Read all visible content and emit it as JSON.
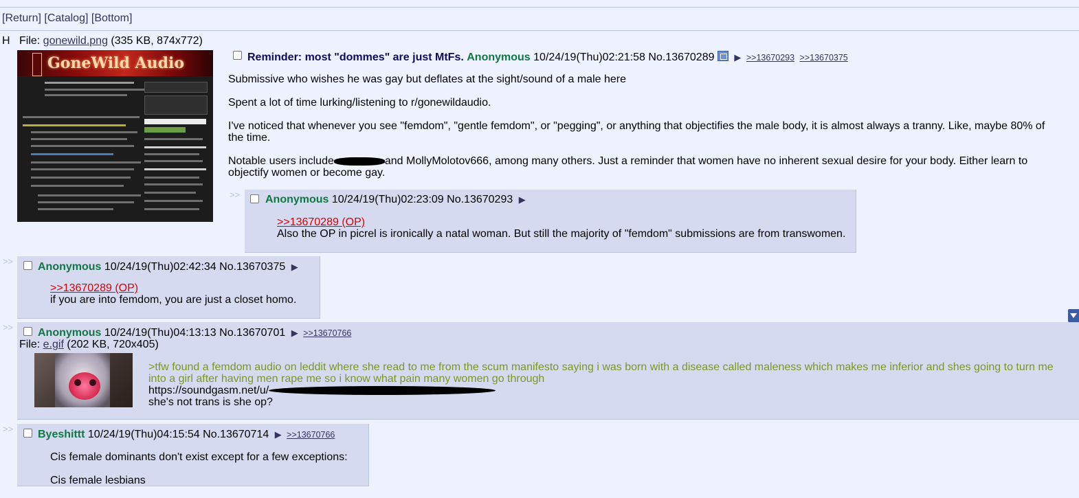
{
  "nav": {
    "return_label": "[Return]",
    "catalog_label": "[Catalog]",
    "bottom_label": "[Bottom]"
  },
  "board_letter": "H",
  "op": {
    "file_prefix": "File: ",
    "file_name": "gonewild.png",
    "file_meta": " (335 KB, 874x772)",
    "thumb_title": "GoneWild Audio",
    "subject": "Reminder: most \"dommes\" are just MtFs.",
    "name": "Anonymous",
    "datetime": "10/24/19(Thu)02:21:58",
    "post_no": "No.13670289",
    "backlinks": [
      ">>13670293",
      ">>13670375"
    ],
    "paragraphs": [
      "Submissive who wishes he was gay but deflates at the sight/sound of a male here",
      "Spent a lot of time lurking/listening to r/gonewildaudio.",
      "I've noticed that whenever you see \"femdom\", \"gentle femdom\", or \"pegging\", or anything that objectifies the male body, it is almost always a tranny. Like, maybe 80% of the time.",
      "Notable users include",
      "and MollyMolotov666, among many others. Just a reminder that women have no inherent sexual desire for your body. Either learn to objectify women or become gay."
    ]
  },
  "replies": [
    {
      "name": "Anonymous",
      "datetime": "10/24/19(Thu)02:23:09",
      "post_no": "No.13670293",
      "quote": ">>13670289 (OP)",
      "text": "Also the OP in picrel is ironically a natal woman. But still the majority of \"femdom\" submissions are from transwomen."
    },
    {
      "name": "Anonymous",
      "datetime": "10/24/19(Thu)02:42:34",
      "post_no": "No.13670375",
      "quote": ">>13670289 (OP)",
      "text": "if you are into femdom, you are just a closet homo."
    },
    {
      "name": "Anonymous",
      "datetime": "10/24/19(Thu)04:13:13",
      "post_no": "No.13670701",
      "backlink": ">>13670766",
      "file_prefix": "File: ",
      "file_name": "e.gif",
      "file_meta": " (202 KB, 720x405)",
      "greentext": ">tfw found a femdom audio on leddit where she read to me from the scum manifesto saying i was born with a disease called maleness which makes me inferior and shes going to turn me into a girl after having men rape me so i know what pain many women go through",
      "link_prefix": "https://soundgasm.net/u/",
      "text": "she's not trans is she op?"
    },
    {
      "name": "Byeshittt",
      "datetime": "10/24/19(Thu)04:15:54",
      "post_no": "No.13670714",
      "backlink": ">>13670766",
      "line1": "Cis female dominants don't exist except for a few exceptions:",
      "line2": "Cis female lesbians"
    }
  ],
  "side_arrows": ">>",
  "post_arrow": "▶"
}
